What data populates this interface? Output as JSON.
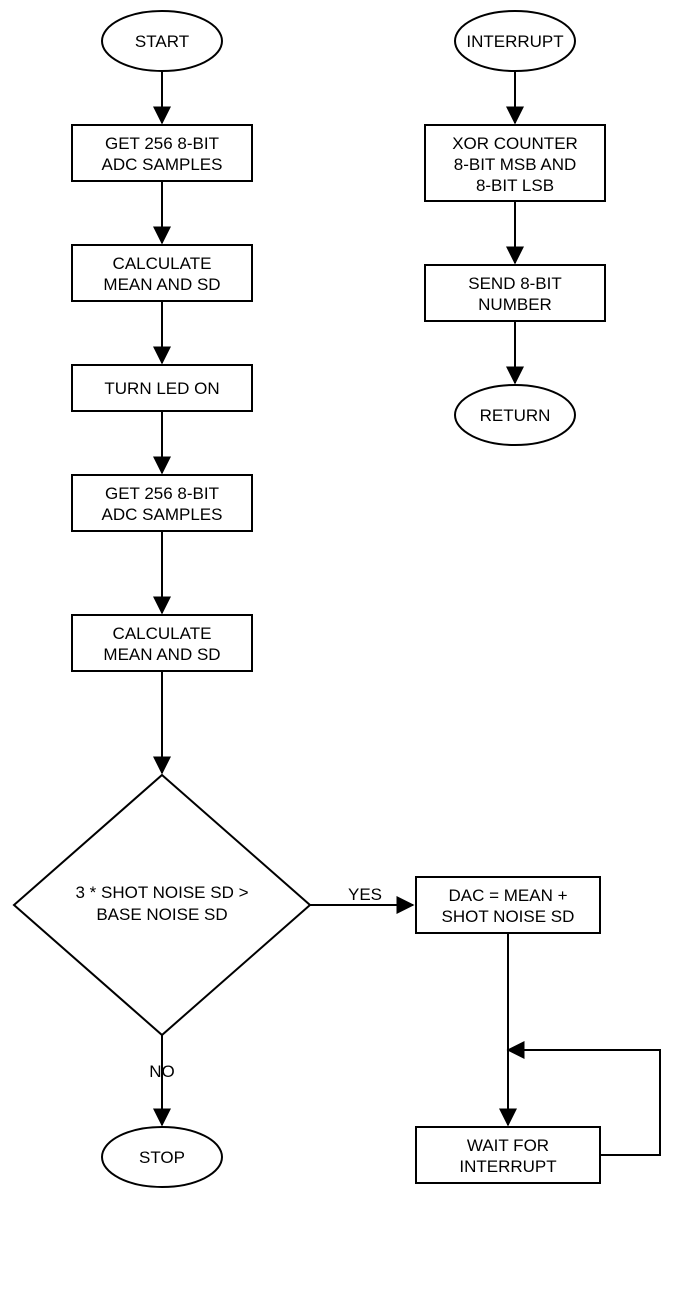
{
  "main": {
    "start": "START",
    "step1_l1": "GET 256 8-BIT",
    "step1_l2": "ADC SAMPLES",
    "step2_l1": "CALCULATE",
    "step2_l2": "MEAN AND SD",
    "step3": "TURN LED ON",
    "step4_l1": "GET 256 8-BIT",
    "step4_l2": "ADC SAMPLES",
    "step5_l1": "CALCULATE",
    "step5_l2": "MEAN AND SD",
    "decision_l1": "3 * SHOT NOISE SD >",
    "decision_l2": "BASE NOISE SD",
    "yes": "YES",
    "no": "NO",
    "dac_l1": "DAC = MEAN +",
    "dac_l2": "SHOT NOISE SD",
    "wait_l1": "WAIT FOR",
    "wait_l2": "INTERRUPT",
    "stop": "STOP"
  },
  "interrupt": {
    "start": "INTERRUPT",
    "step1_l1": "XOR COUNTER",
    "step1_l2": "8-BIT MSB AND",
    "step1_l3": "8-BIT LSB",
    "step2_l1": "SEND 8-BIT",
    "step2_l2": "NUMBER",
    "return": "RETURN"
  },
  "chart_data": {
    "type": "flowchart",
    "flows": [
      {
        "name": "main",
        "nodes": [
          {
            "id": "start",
            "shape": "terminator",
            "text": "START"
          },
          {
            "id": "s1",
            "shape": "process",
            "text": "GET 256 8-BIT ADC SAMPLES"
          },
          {
            "id": "s2",
            "shape": "process",
            "text": "CALCULATE MEAN AND SD"
          },
          {
            "id": "s3",
            "shape": "process",
            "text": "TURN LED ON"
          },
          {
            "id": "s4",
            "shape": "process",
            "text": "GET 256 8-BIT ADC SAMPLES"
          },
          {
            "id": "s5",
            "shape": "process",
            "text": "CALCULATE MEAN AND SD"
          },
          {
            "id": "d1",
            "shape": "decision",
            "text": "3 * SHOT NOISE SD > BASE NOISE SD"
          },
          {
            "id": "stop",
            "shape": "terminator",
            "text": "STOP"
          },
          {
            "id": "dac",
            "shape": "process",
            "text": "DAC = MEAN + SHOT NOISE SD"
          },
          {
            "id": "wait",
            "shape": "process",
            "text": "WAIT FOR INTERRUPT"
          }
        ],
        "edges": [
          {
            "from": "start",
            "to": "s1"
          },
          {
            "from": "s1",
            "to": "s2"
          },
          {
            "from": "s2",
            "to": "s3"
          },
          {
            "from": "s3",
            "to": "s4"
          },
          {
            "from": "s4",
            "to": "s5"
          },
          {
            "from": "s5",
            "to": "d1"
          },
          {
            "from": "d1",
            "to": "stop",
            "label": "NO"
          },
          {
            "from": "d1",
            "to": "dac",
            "label": "YES"
          },
          {
            "from": "dac",
            "to": "wait"
          },
          {
            "from": "wait",
            "to": "wait",
            "label": "self-loop"
          }
        ]
      },
      {
        "name": "interrupt",
        "nodes": [
          {
            "id": "int",
            "shape": "terminator",
            "text": "INTERRUPT"
          },
          {
            "id": "i1",
            "shape": "process",
            "text": "XOR COUNTER 8-BIT MSB AND 8-BIT LSB"
          },
          {
            "id": "i2",
            "shape": "process",
            "text": "SEND 8-BIT NUMBER"
          },
          {
            "id": "ret",
            "shape": "terminator",
            "text": "RETURN"
          }
        ],
        "edges": [
          {
            "from": "int",
            "to": "i1"
          },
          {
            "from": "i1",
            "to": "i2"
          },
          {
            "from": "i2",
            "to": "ret"
          }
        ]
      }
    ]
  }
}
